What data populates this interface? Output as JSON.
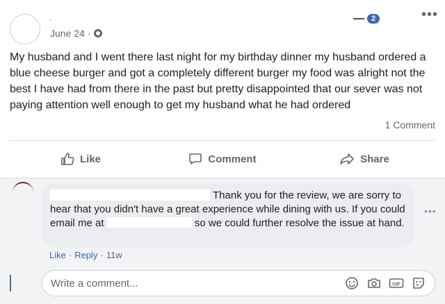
{
  "post": {
    "author": "·",
    "date": "June 24",
    "separator": "·",
    "text": "My husband and I went there last night for my birthday dinner my husband ordered a blue cheese burger and got a completely different burger my food was alright not the best I have had from there in the past but pretty disappointed that our sever was not paying attention well enough to get my husband what he had ordered",
    "comment_count": "1 Comment"
  },
  "notification": {
    "badge": "2"
  },
  "actions": {
    "like": "Like",
    "comment": "Comment",
    "share": "Share"
  },
  "reply": {
    "text_part1": "Thank you for the review, we are sorry to hear that you didn't have a great experience while dining with us. If you could email me at",
    "text_part2": "so we could further resolve the issue at hand.",
    "like": "Like",
    "reply": "Reply",
    "dot": "·",
    "time": "11w"
  },
  "composer": {
    "placeholder": "Write a comment..."
  },
  "colors": {
    "brand": "#4267b2",
    "text": "#1c1e21",
    "muted": "#606770"
  }
}
